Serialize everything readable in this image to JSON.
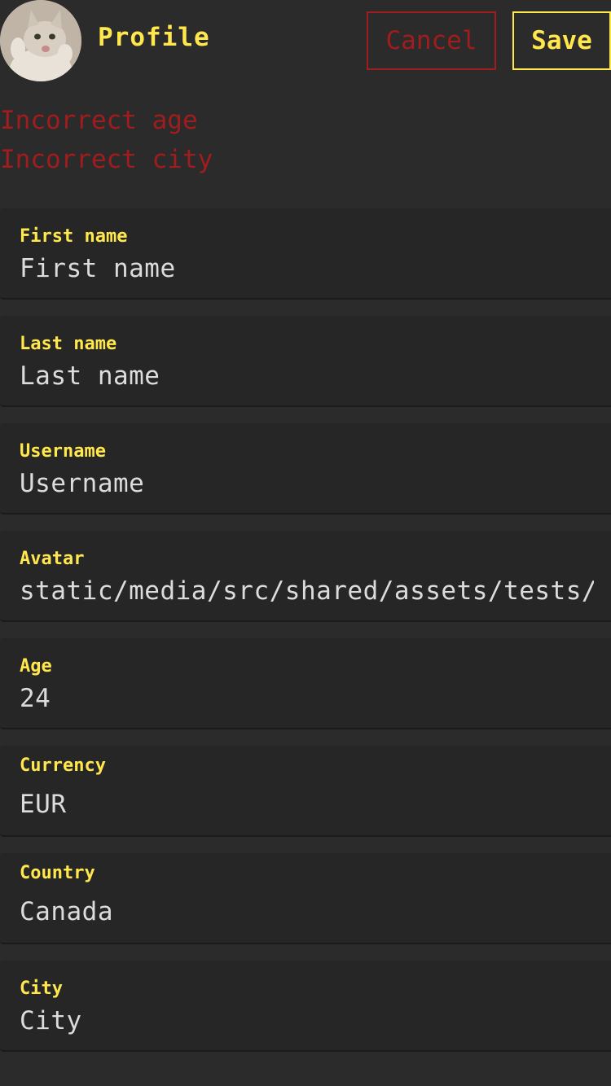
{
  "header": {
    "title": "Profile",
    "cancel_label": "Cancel",
    "save_label": "Save",
    "avatar_alt": "cat avatar"
  },
  "errors": [
    "Incorrect age",
    "Incorrect city"
  ],
  "fields": [
    {
      "label": "First name",
      "value": "First name",
      "type": "text"
    },
    {
      "label": "Last name",
      "value": "Last name",
      "type": "text"
    },
    {
      "label": "Username",
      "value": "Username",
      "type": "text"
    },
    {
      "label": "Avatar",
      "value": "static/media/src/shared/assets/tests/",
      "type": "text"
    },
    {
      "label": "Age",
      "value": "24",
      "type": "text"
    },
    {
      "label": "Currency",
      "value": "EUR",
      "type": "select"
    },
    {
      "label": "Country",
      "value": "Canada",
      "type": "select"
    },
    {
      "label": "City",
      "value": "City",
      "type": "text"
    }
  ],
  "colors": {
    "background": "#2b2b2b",
    "field_background": "#262626",
    "accent": "#ffe74c",
    "error": "#a11c1c",
    "text": "#dcdcdc"
  }
}
